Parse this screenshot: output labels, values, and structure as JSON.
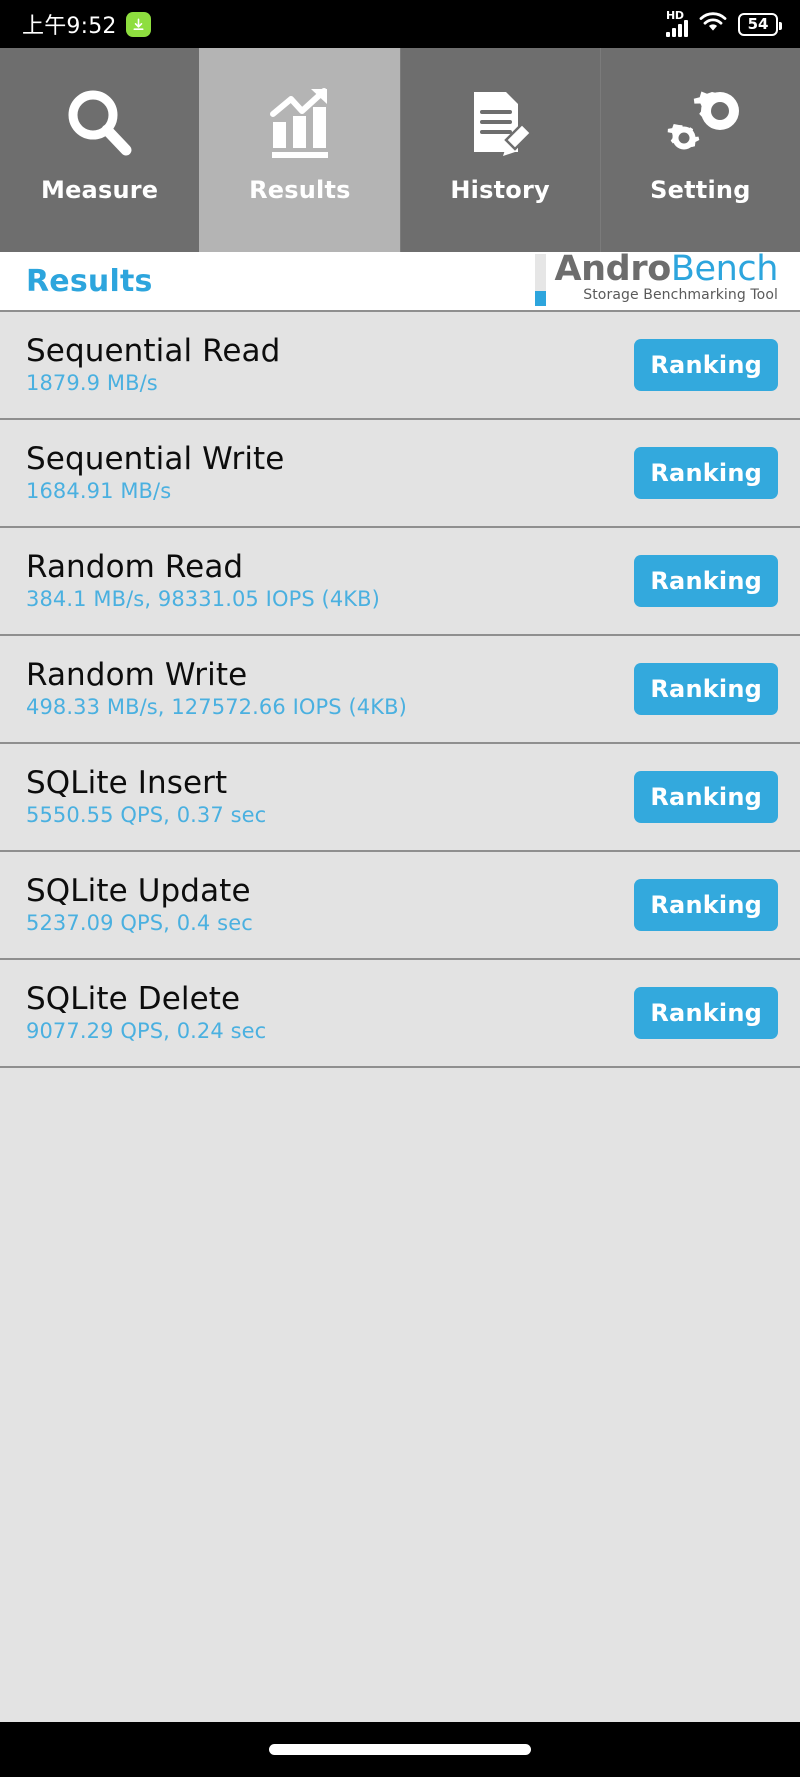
{
  "status_bar": {
    "time": "上午9:52",
    "download_icon": "download-arrow-icon",
    "network_label": "HD",
    "signal_icon": "signal-bars-icon",
    "wifi_icon": "wifi-icon",
    "battery_level": "54"
  },
  "tabs": [
    {
      "label": "Measure",
      "icon": "magnifier-icon",
      "active": false
    },
    {
      "label": "Results",
      "icon": "bar-chart-arrow-icon",
      "active": true
    },
    {
      "label": "History",
      "icon": "document-pencil-icon",
      "active": false
    },
    {
      "label": "Setting",
      "icon": "gears-icon",
      "active": false
    }
  ],
  "header": {
    "title": "Results",
    "brand_first": "Andro",
    "brand_second": "Bench",
    "brand_tagline": "Storage Benchmarking Tool"
  },
  "results": {
    "button_label": "Ranking",
    "rows": [
      {
        "title": "Sequential Read",
        "value": "1879.9 MB/s"
      },
      {
        "title": "Sequential Write",
        "value": "1684.91 MB/s"
      },
      {
        "title": "Random Read",
        "value": "384.1 MB/s, 98331.05 IOPS (4KB)"
      },
      {
        "title": "Random Write",
        "value": "498.33 MB/s, 127572.66 IOPS (4KB)"
      },
      {
        "title": "SQLite Insert",
        "value": "5550.55 QPS, 0.37 sec"
      },
      {
        "title": "SQLite Update",
        "value": "5237.09 QPS, 0.4 sec"
      },
      {
        "title": "SQLite Delete",
        "value": "9077.29 QPS, 0.24 sec"
      }
    ]
  },
  "colors": {
    "accent_blue": "#33a9dd",
    "value_blue": "#4ab0e0",
    "tab_inactive": "#6e6e6e",
    "tab_active": "#b4b4b4",
    "list_bg": "#e3e3e3",
    "battery_badge_green": "#8ede3f"
  },
  "nav_bar": {
    "gesture_pill": "home-gesture-pill"
  }
}
